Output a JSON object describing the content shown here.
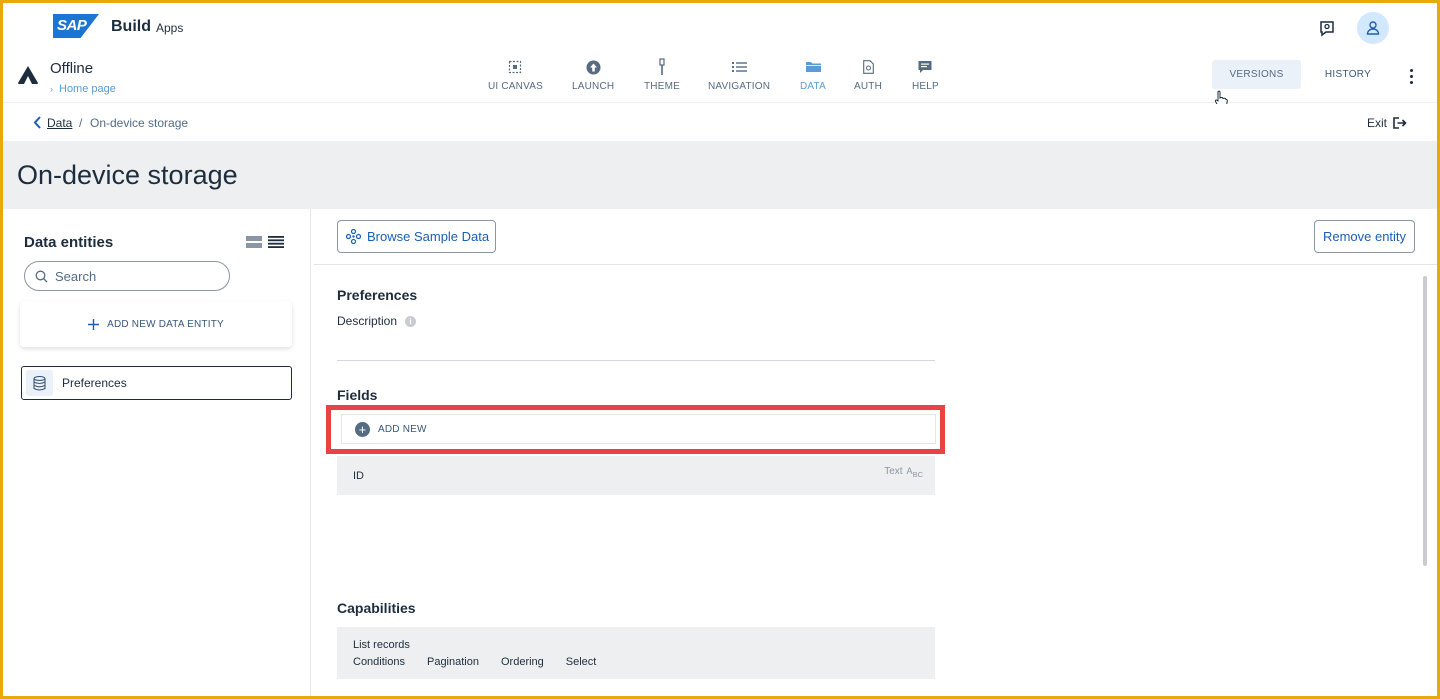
{
  "shell": {
    "logo_text": "SAP",
    "brand": "Build",
    "brand_sub": "Apps"
  },
  "app": {
    "title": "Offline",
    "subtitle": "Home page"
  },
  "nav": {
    "items": [
      {
        "label": "UI CANVAS",
        "icon": "canvas-icon"
      },
      {
        "label": "LAUNCH",
        "icon": "launch-icon"
      },
      {
        "label": "THEME",
        "icon": "brush-icon"
      },
      {
        "label": "NAVIGATION",
        "icon": "list-icon"
      },
      {
        "label": "DATA",
        "icon": "folder-icon",
        "active": true
      },
      {
        "label": "AUTH",
        "icon": "document-icon"
      },
      {
        "label": "HELP",
        "icon": "chat-icon"
      }
    ],
    "versions": "VERSIONS",
    "history": "HISTORY"
  },
  "breadcrumb": {
    "parent": "Data",
    "separator": "/",
    "current": "On-device storage",
    "exit": "Exit"
  },
  "page": {
    "title": "On-device storage"
  },
  "left": {
    "title": "Data entities",
    "search_placeholder": "Search",
    "add_entity": "ADD NEW DATA ENTITY",
    "entities": [
      "Preferences"
    ]
  },
  "toolbar": {
    "browse": "Browse Sample Data",
    "remove": "Remove entity"
  },
  "entity": {
    "name": "Preferences",
    "description_label": "Description",
    "fields_title": "Fields",
    "add_new": "ADD NEW",
    "fields": [
      {
        "name": "ID",
        "type": "Text",
        "type_glyph": "ABC"
      }
    ],
    "capabilities_title": "Capabilities",
    "capabilities_group": "List records",
    "capabilities": [
      "Conditions",
      "Pagination",
      "Ordering",
      "Select"
    ]
  },
  "colors": {
    "accent": "#1b5fb4",
    "active_nav": "#5b9bd5",
    "highlight": "#e84242",
    "frame": "#e8a90a"
  }
}
